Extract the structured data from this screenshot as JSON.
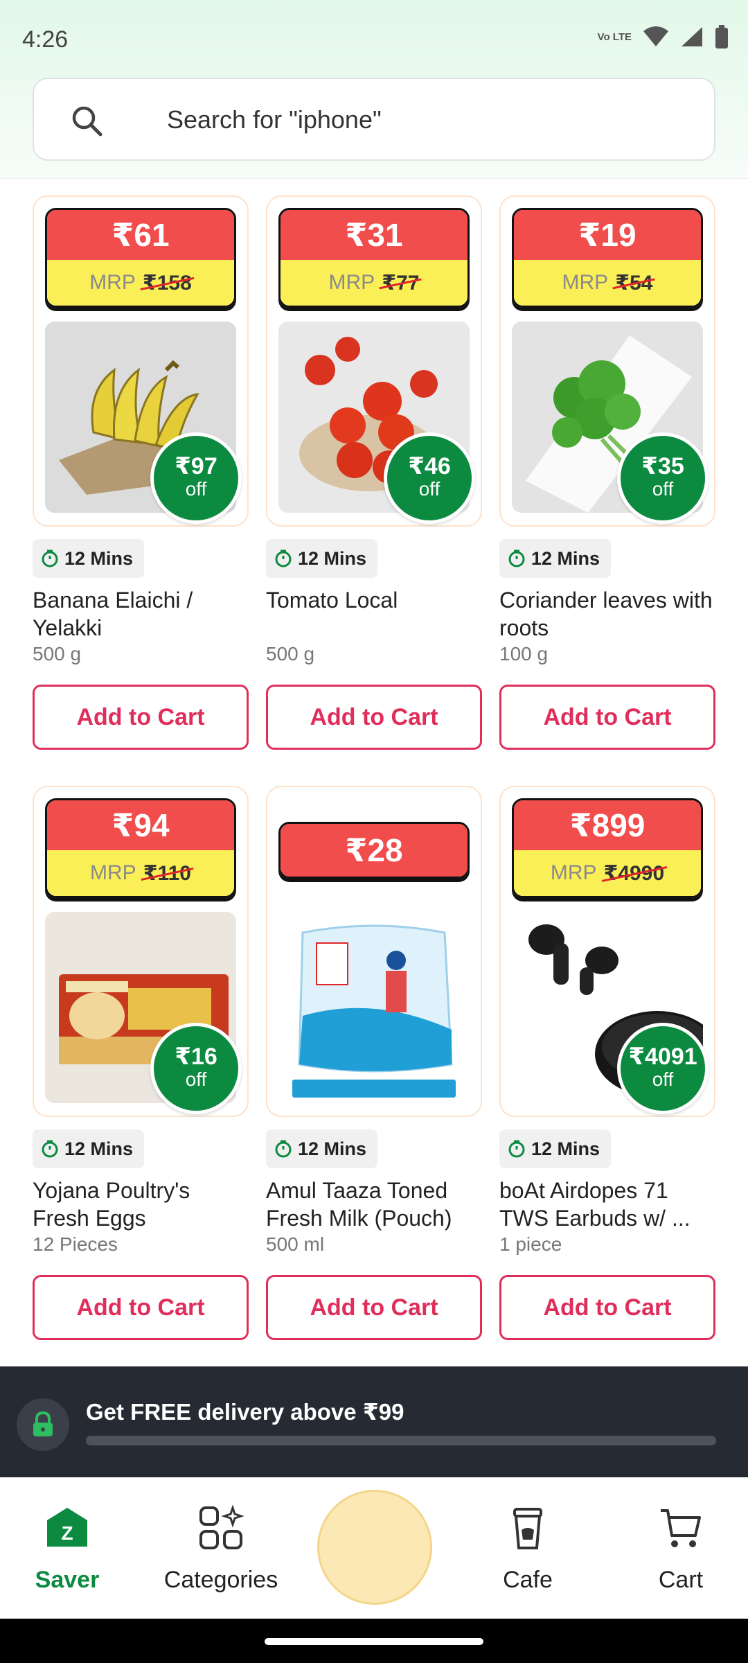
{
  "status_bar": {
    "time": "4:26",
    "network_label": "Vo LTE"
  },
  "search": {
    "placeholder": "Search for \"iphone\""
  },
  "products": [
    {
      "price": "₹61",
      "mrp_label": "MRP",
      "mrp_value": "₹158",
      "off_amount": "₹97",
      "off_label": "off",
      "eta": "12 Mins",
      "name": "Banana Elaichi / Yelakki",
      "quantity": "500 g",
      "button": "Add to Cart",
      "image": "banana"
    },
    {
      "price": "₹31",
      "mrp_label": "MRP",
      "mrp_value": "₹77",
      "off_amount": "₹46",
      "off_label": "off",
      "eta": "12 Mins",
      "name": "Tomato Local",
      "quantity": "500 g",
      "button": "Add to Cart",
      "image": "tomato"
    },
    {
      "price": "₹19",
      "mrp_label": "MRP",
      "mrp_value": "₹54",
      "off_amount": "₹35",
      "off_label": "off",
      "eta": "12 Mins",
      "name": "Coriander leaves with roots",
      "quantity": "100 g",
      "button": "Add to Cart",
      "image": "coriander"
    },
    {
      "price": "₹94",
      "mrp_label": "MRP",
      "mrp_value": "₹110",
      "off_amount": "₹16",
      "off_label": "off",
      "eta": "12 Mins",
      "name": "Yojana Poultry's Fresh Eggs",
      "quantity": "12 Pieces",
      "button": "Add to Cart",
      "image": "eggs"
    },
    {
      "price": "₹28",
      "eta": "12 Mins",
      "name": "Amul Taaza Toned Fresh Milk (Pouch)",
      "quantity": "500 ml",
      "button": "Add to Cart",
      "image": "milk"
    },
    {
      "price": "₹899",
      "mrp_label": "MRP",
      "mrp_value": "₹4990",
      "off_amount": "₹4091",
      "off_label": "off",
      "eta": "12 Mins",
      "name": "boAt Airdopes 71 TWS Earbuds w/ ...",
      "quantity": "1 piece",
      "button": "Add to Cart",
      "image": "earbuds"
    }
  ],
  "delivery_banner": {
    "text": "Get FREE delivery above ₹99",
    "progress": 0
  },
  "bottom_nav": [
    {
      "label": "Saver",
      "icon": "saver-icon",
      "active": true
    },
    {
      "label": "Categories",
      "icon": "categories-icon",
      "active": false
    },
    {
      "label": "",
      "icon": "center-action",
      "active": false
    },
    {
      "label": "Cafe",
      "icon": "cafe-icon",
      "active": false
    },
    {
      "label": "Cart",
      "icon": "cart-icon",
      "active": false
    }
  ],
  "colors": {
    "accent_green": "#0c8a40",
    "price_red": "#f24d4d",
    "mrp_yellow": "#fbef57",
    "button_pink": "#e02e5a",
    "banner_dark": "#262a33"
  }
}
